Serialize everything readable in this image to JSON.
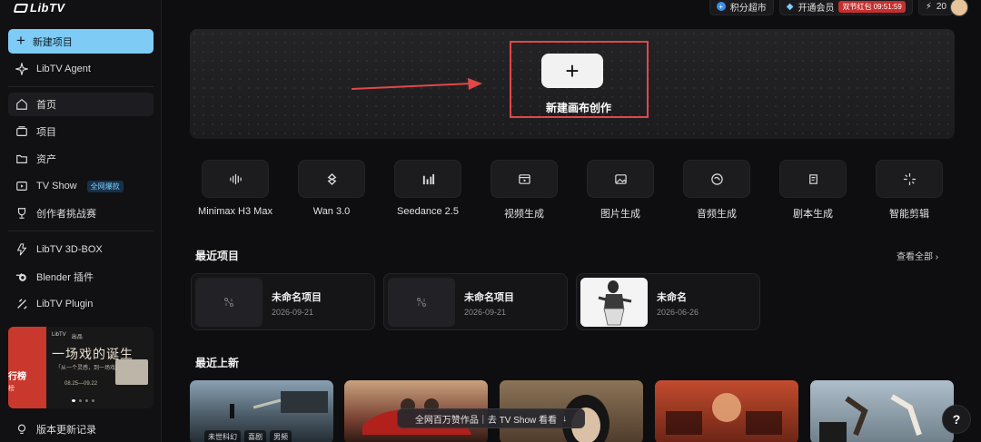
{
  "app": {
    "logo": "LibTV"
  },
  "sidebar": {
    "new_project": "新建项目",
    "agent": "LibTV Agent",
    "home": "首页",
    "projects": "项目",
    "assets": "资产",
    "tv_show": "TV Show",
    "tv_show_badge": "全网爆款",
    "challenge": "创作者挑战赛",
    "box3d": "LibTV 3D-BOX",
    "blender": "Blender 插件",
    "plugin": "LibTV Plugin",
    "changelog": "版本更新记录",
    "promo": {
      "logo_a": "LibTV",
      "logo_b": "出品",
      "title": "一场戏的诞生",
      "tagline": "「从一个灵感，到一场戏」",
      "date": "08.25—09.22",
      "side_label": "行榜",
      "side_sub": "榜"
    }
  },
  "topbar": {
    "points_shop": "积分超市",
    "membership": "开通会员",
    "timer": "双节红包 09:51:59",
    "credits": "20"
  },
  "hero": {
    "plus": "+",
    "label": "新建画布创作"
  },
  "tools": [
    {
      "label": "Minimax H3 Max",
      "icon": "waveform-icon"
    },
    {
      "label": "Wan 3.0",
      "icon": "spiral-icon"
    },
    {
      "label": "Seedance 2.5",
      "icon": "bars-icon"
    },
    {
      "label": "视频生成",
      "icon": "video-icon"
    },
    {
      "label": "图片生成",
      "icon": "image-icon"
    },
    {
      "label": "音频生成",
      "icon": "audio-icon"
    },
    {
      "label": "剧本生成",
      "icon": "script-icon"
    },
    {
      "label": "智能剪辑",
      "icon": "sparkle-icon"
    }
  ],
  "recent": {
    "title": "最近项目",
    "see_all": "查看全部",
    "items": [
      {
        "name": "未命名项目",
        "date": "2026-09-21"
      },
      {
        "name": "未命名项目",
        "date": "2026-09-21"
      },
      {
        "name": "未命名",
        "date": "2026-06-26"
      }
    ]
  },
  "latest": {
    "title": "最近上新",
    "card1_tags": [
      "未世科幻",
      "喜剧",
      "男频"
    ],
    "banner": "全网百万赞作品｜去 TV Show 看看",
    "banner_icon": "↓"
  },
  "help": "?",
  "colors": {
    "accent": "#7ecbf5",
    "highlight": "#e04848",
    "timer": "#c52f2f"
  }
}
